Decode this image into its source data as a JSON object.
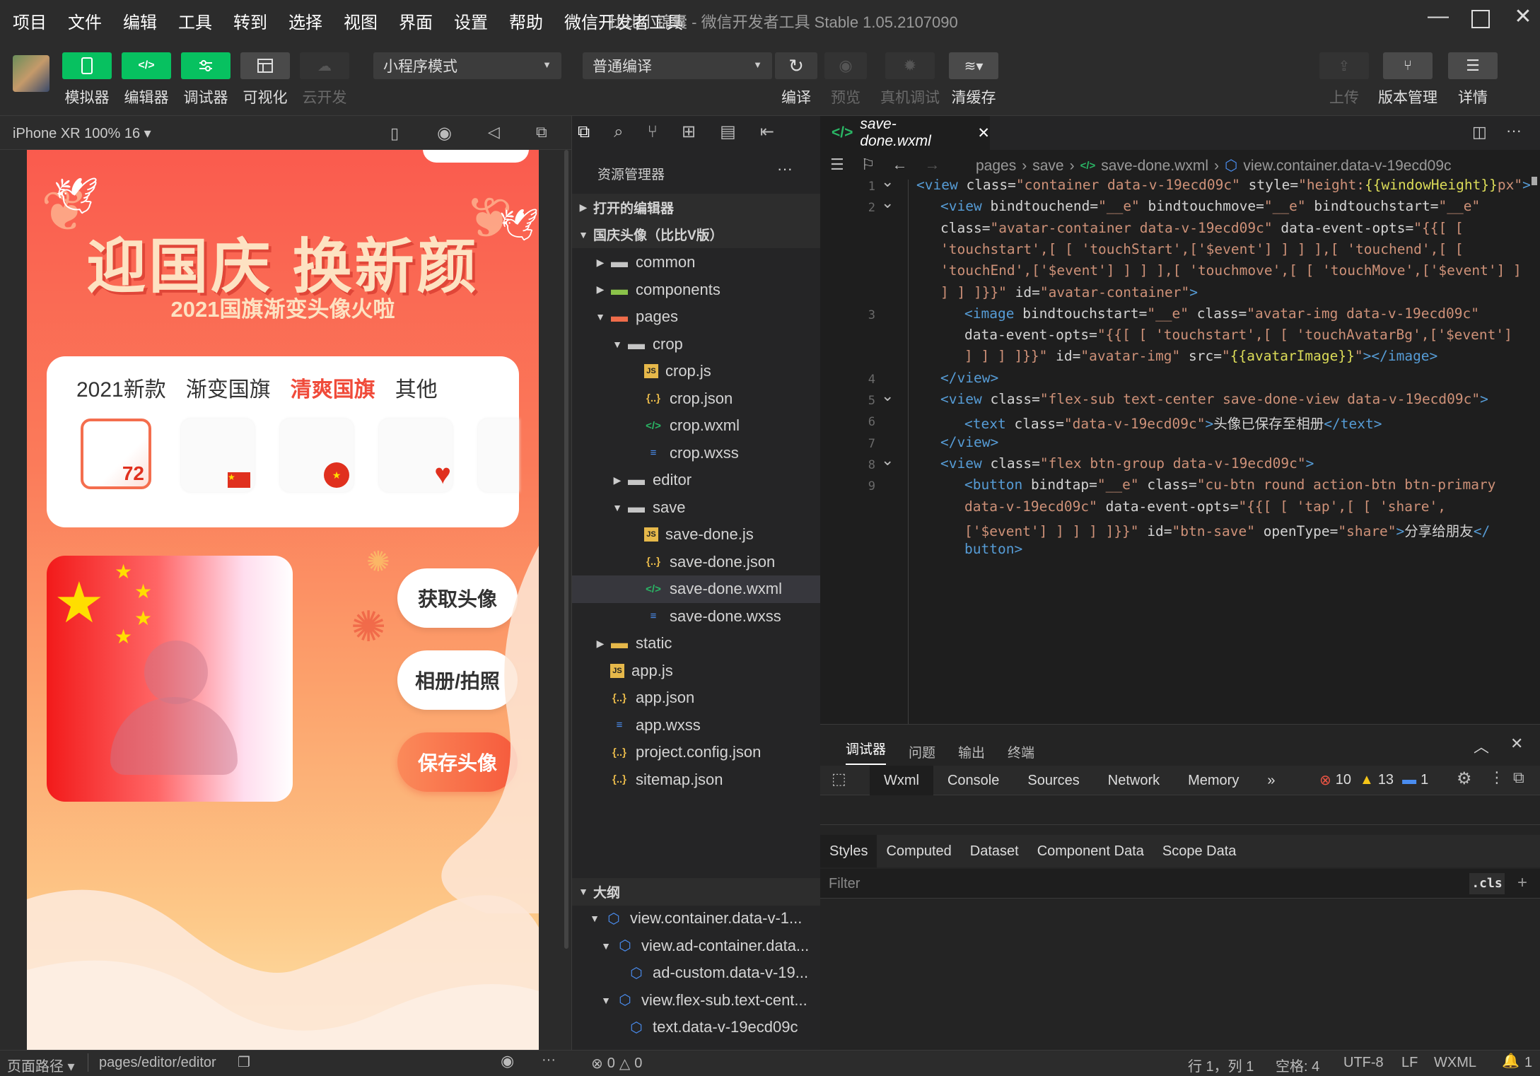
{
  "menubar": {
    "items": [
      "项目",
      "文件",
      "编辑",
      "工具",
      "转到",
      "选择",
      "视图",
      "界面",
      "设置",
      "帮助",
      "微信开发者工具"
    ],
    "title_app": "比比小锦囊",
    "title_rest": " - 微信开发者工具 Stable 1.05.2107090"
  },
  "toolbar": {
    "simulator": "模拟器",
    "editor": "编辑器",
    "debugger": "调试器",
    "visual": "可视化",
    "cloud": "云开发",
    "mode": "小程序模式",
    "compile_mode": "普通编译",
    "compile": "编译",
    "preview": "预览",
    "real_debug": "真机调试",
    "clear_cache": "清缓存",
    "upload": "上传",
    "version": "版本管理",
    "details": "详情"
  },
  "sim": {
    "device": "iPhone XR 100% 16 ▾",
    "banner_title": "迎国庆 换新颜",
    "banner_sub": "2021国旗渐变头像火啦",
    "tabs": [
      "2021新款",
      "渐变国旗",
      "清爽国旗",
      "其他"
    ],
    "active_tab": "清爽国旗",
    "buttons": {
      "get": "获取头像",
      "album": "相册/拍照",
      "save": "保存头像"
    }
  },
  "footer": {
    "page_path_label": "页面路径 ▾",
    "page_path": "pages/editor/editor",
    "errors": "0",
    "warnings": "0",
    "cursor": "行 1，列 1",
    "spaces": "空格: 4",
    "encoding": "UTF-8",
    "eol": "LF",
    "lang": "WXML",
    "notif": "1"
  },
  "explorer": {
    "title": "资源管理器",
    "open_editors": "打开的编辑器",
    "project": "国庆头像（比比V版）",
    "files": [
      {
        "d": 1,
        "t": "folder",
        "n": "common",
        "o": false
      },
      {
        "d": 1,
        "t": "folder-g",
        "n": "components",
        "o": false
      },
      {
        "d": 1,
        "t": "folder-r",
        "n": "pages",
        "o": true
      },
      {
        "d": 2,
        "t": "folder",
        "n": "crop",
        "o": true
      },
      {
        "d": 3,
        "t": "js",
        "n": "crop.js"
      },
      {
        "d": 3,
        "t": "json",
        "n": "crop.json"
      },
      {
        "d": 3,
        "t": "wxml",
        "n": "crop.wxml"
      },
      {
        "d": 3,
        "t": "wxss",
        "n": "crop.wxss"
      },
      {
        "d": 2,
        "t": "folder",
        "n": "editor",
        "o": false
      },
      {
        "d": 2,
        "t": "folder",
        "n": "save",
        "o": true
      },
      {
        "d": 3,
        "t": "js",
        "n": "save-done.js"
      },
      {
        "d": 3,
        "t": "json",
        "n": "save-done.json"
      },
      {
        "d": 3,
        "t": "wxml",
        "n": "save-done.wxml",
        "sel": true
      },
      {
        "d": 3,
        "t": "wxss",
        "n": "save-done.wxss"
      },
      {
        "d": 1,
        "t": "folder-y",
        "n": "static",
        "o": false
      },
      {
        "d": 1,
        "t": "js",
        "n": "app.js"
      },
      {
        "d": 1,
        "t": "json",
        "n": "app.json"
      },
      {
        "d": 1,
        "t": "wxss",
        "n": "app.wxss"
      },
      {
        "d": 1,
        "t": "json",
        "n": "project.config.json"
      },
      {
        "d": 1,
        "t": "json",
        "n": "sitemap.json"
      }
    ],
    "outline_title": "大纲",
    "outline": [
      {
        "d": 1,
        "o": true,
        "n": "view.container.data-v-1..."
      },
      {
        "d": 2,
        "o": true,
        "n": "view.ad-container.data..."
      },
      {
        "d": 3,
        "n": "ad-custom.data-v-19..."
      },
      {
        "d": 2,
        "o": true,
        "n": "view.flex-sub.text-cent..."
      },
      {
        "d": 3,
        "n": "text.data-v-19ecd09c"
      }
    ]
  },
  "editor": {
    "tab": "save-done.wxml",
    "crumbs": [
      "pages",
      "save",
      "save-done.wxml",
      "view.container.data-v-19ecd09c"
    ],
    "lines": [
      {
        "n": "1",
        "f": true,
        "p": 0,
        "h": "<span class='t'>&lt;view</span> <span class='a'>class</span>=<span class='s'>\"container data-v-19ecd09c\"</span> <span class='a'>style</span>=<span class='s'>\"height:<span class='y'>{{windowHeight}}</span>px\"</span><span class='t'>&gt;</span>"
      },
      {
        "n": "2",
        "f": true,
        "p": 1,
        "h": "<span class='t'>&lt;view</span> <span class='a'>bindtouchend</span>=<span class='s'>\"__e\"</span> <span class='a'>bindtouchmove</span>=<span class='s'>\"__e\"</span> <span class='a'>bindtouchstart</span>=<span class='s'>\"__e\"</span>"
      },
      {
        "n": "",
        "p": 1,
        "h": "<span class='a'>class</span>=<span class='s'>\"avatar-container data-v-19ecd09c\"</span> <span class='a'>data-event-opts</span>=<span class='s'>\"{{[ [</span>"
      },
      {
        "n": "",
        "p": 1,
        "h": "<span class='s'>'touchstart',[ [ 'touchStart',['$event'] ] ] ],[ 'touchend',[ [</span>"
      },
      {
        "n": "",
        "p": 1,
        "h": "<span class='s'>'touchEnd',['$event'] ] ] ],[ 'touchmove',[ [ 'touchMove',['$event'] ]</span>"
      },
      {
        "n": "",
        "p": 1,
        "h": "<span class='s'>] ] ]}}\"</span> <span class='a'>id</span>=<span class='s'>\"avatar-container\"</span><span class='t'>&gt;</span>"
      },
      {
        "n": "3",
        "p": 2,
        "h": "<span class='t'>&lt;image</span> <span class='a'>bindtouchstart</span>=<span class='s'>\"__e\"</span> <span class='a'>class</span>=<span class='s'>\"avatar-img data-v-19ecd09c\"</span>"
      },
      {
        "n": "",
        "p": 2,
        "h": "<span class='a'>data-event-opts</span>=<span class='s'>\"{{[ [ 'touchstart',[ [ 'touchAvatarBg',['$event']</span>"
      },
      {
        "n": "",
        "p": 2,
        "h": "<span class='s'>] ] ] ]}}\"</span> <span class='a'>id</span>=<span class='s'>\"avatar-img\"</span> <span class='a'>src</span>=<span class='s'>\"<span class='y'>{{avatarImage}}</span>\"</span><span class='t'>&gt;&lt;/image&gt;</span>"
      },
      {
        "n": "4",
        "p": 1,
        "h": "<span class='t'>&lt;/view&gt;</span>"
      },
      {
        "n": "5",
        "f": true,
        "p": 1,
        "h": "<span class='t'>&lt;view</span> <span class='a'>class</span>=<span class='s'>\"flex-sub text-center save-done-view data-v-19ecd09c\"</span><span class='t'>&gt;</span>"
      },
      {
        "n": "6",
        "p": 2,
        "h": "<span class='t'>&lt;text</span> <span class='a'>class</span>=<span class='s'>\"data-v-19ecd09c\"</span><span class='t'>&gt;</span><span class='x'>头像已保存至相册</span><span class='t'>&lt;/text&gt;</span>"
      },
      {
        "n": "7",
        "p": 1,
        "h": "<span class='t'>&lt;/view&gt;</span>"
      },
      {
        "n": "8",
        "f": true,
        "p": 1,
        "h": "<span class='t'>&lt;view</span> <span class='a'>class</span>=<span class='s'>\"flex btn-group data-v-19ecd09c\"</span><span class='t'>&gt;</span>"
      },
      {
        "n": "9",
        "p": 2,
        "h": "<span class='t'>&lt;button</span> <span class='a'>bindtap</span>=<span class='s'>\"__e\"</span> <span class='a'>class</span>=<span class='s'>\"cu-btn round action-btn btn-primary</span>"
      },
      {
        "n": "",
        "p": 2,
        "h": "<span class='s'>data-v-19ecd09c\"</span> <span class='a'>data-event-opts</span>=<span class='s'>\"{{[ [ 'tap',[ [ 'share',</span>"
      },
      {
        "n": "",
        "p": 2,
        "h": "<span class='s'>['$event'] ] ] ] ]}}\"</span> <span class='a'>id</span>=<span class='s'>\"btn-save\"</span> <span class='a'>openType</span>=<span class='s'>\"share\"</span><span class='t'>&gt;</span><span class='x'>分享给朋友</span><span class='t'>&lt;/</span>"
      },
      {
        "n": "",
        "p": 2,
        "h": "<span class='t'>button&gt;</span>"
      }
    ]
  },
  "devtools": {
    "tabs": [
      "调试器",
      "问题",
      "输出",
      "终端"
    ],
    "panels": [
      "Wxml",
      "Console",
      "Sources",
      "Network",
      "Memory",
      "»"
    ],
    "err": "10",
    "warn": "13",
    "info": "1",
    "subtabs": [
      "Styles",
      "Computed",
      "Dataset",
      "Component Data",
      "Scope Data"
    ],
    "filter": "Filter",
    "cls": ".cls"
  },
  "colors": {
    "green": "#07c160",
    "accent": "#f04b3a"
  }
}
